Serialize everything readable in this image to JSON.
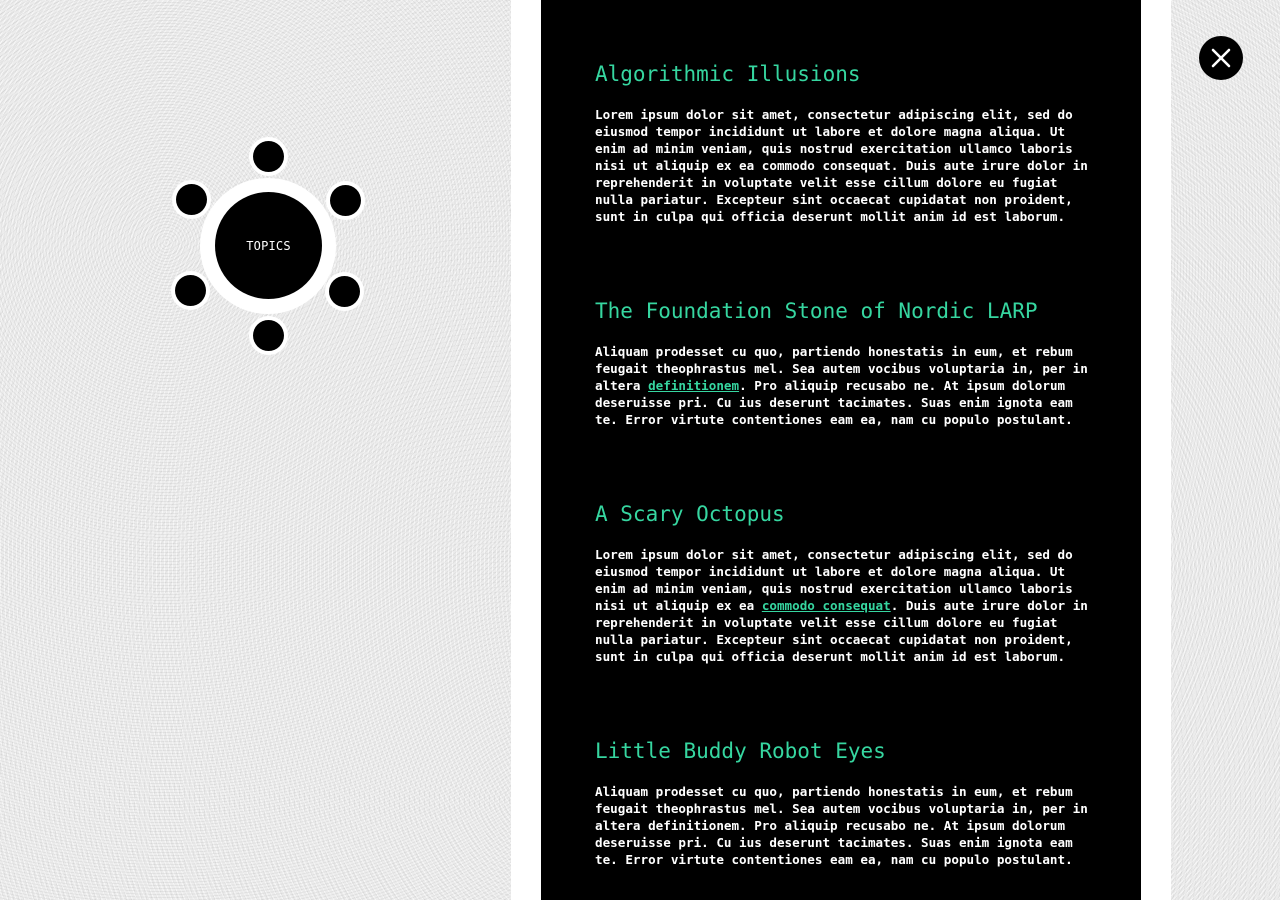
{
  "topics_menu": {
    "hub_label": "TOPICS",
    "node_count": 6
  },
  "close_button": {
    "icon": "close-icon"
  },
  "colors": {
    "accent": "#36d6a0",
    "panel_background": "#000000",
    "page_background": "#ececec",
    "body_text": "#ffffff"
  },
  "articles": [
    {
      "title": "Algorithmic Illusions",
      "body_before": "Lorem ipsum dolor sit amet, consectetur adipiscing elit, sed do eiusmod tempor incididunt ut labore et dolore magna aliqua. Ut enim ad minim veniam, quis nostrud exercitation ullamco laboris nisi ut aliquip ex ea commodo consequat. Duis aute irure dolor in reprehenderit in voluptate velit esse cillum dolore eu fugiat nulla pariatur. Excepteur sint occaecat cupidatat non proident, sunt in culpa qui officia deserunt mollit anim id est laborum.",
      "link": "",
      "body_after": ""
    },
    {
      "title": "The Foundation Stone of Nordic LARP",
      "body_before": "Aliquam prodesset cu quo, partiendo honestatis in eum, et rebum feugait theophrastus mel. Sea autem vocibus voluptaria in, per in altera ",
      "link": "definitionem",
      "body_after": ". Pro aliquip recusabo ne. At ipsum dolorum deseruisse pri. Cu ius deserunt tacimates. Suas enim ignota eam te. Error virtute contentiones eam ea, nam cu populo postulant."
    },
    {
      "title": "A Scary Octopus",
      "body_before": "Lorem ipsum dolor sit amet, consectetur adipiscing elit, sed do eiusmod tempor incididunt ut labore et dolore magna aliqua. Ut enim ad minim veniam, quis nostrud exercitation ullamco laboris nisi ut aliquip ex ea ",
      "link": "commodo consequat",
      "body_after": ". Duis aute irure dolor in reprehenderit in voluptate velit esse cillum dolore eu fugiat nulla pariatur. Excepteur sint occaecat cupidatat non proident, sunt in culpa qui officia deserunt mollit anim id est laborum."
    },
    {
      "title": "Little Buddy Robot Eyes",
      "body_before": "Aliquam prodesset cu quo, partiendo honestatis in eum, et rebum feugait theophrastus mel. Sea autem vocibus voluptaria in, per in altera definitionem. Pro aliquip recusabo ne. At ipsum dolorum deseruisse pri. Cu ius deserunt tacimates. Suas enim ignota eam te. Error virtute contentiones eam ea, nam cu populo postulant.",
      "link": "",
      "body_after": ""
    }
  ]
}
